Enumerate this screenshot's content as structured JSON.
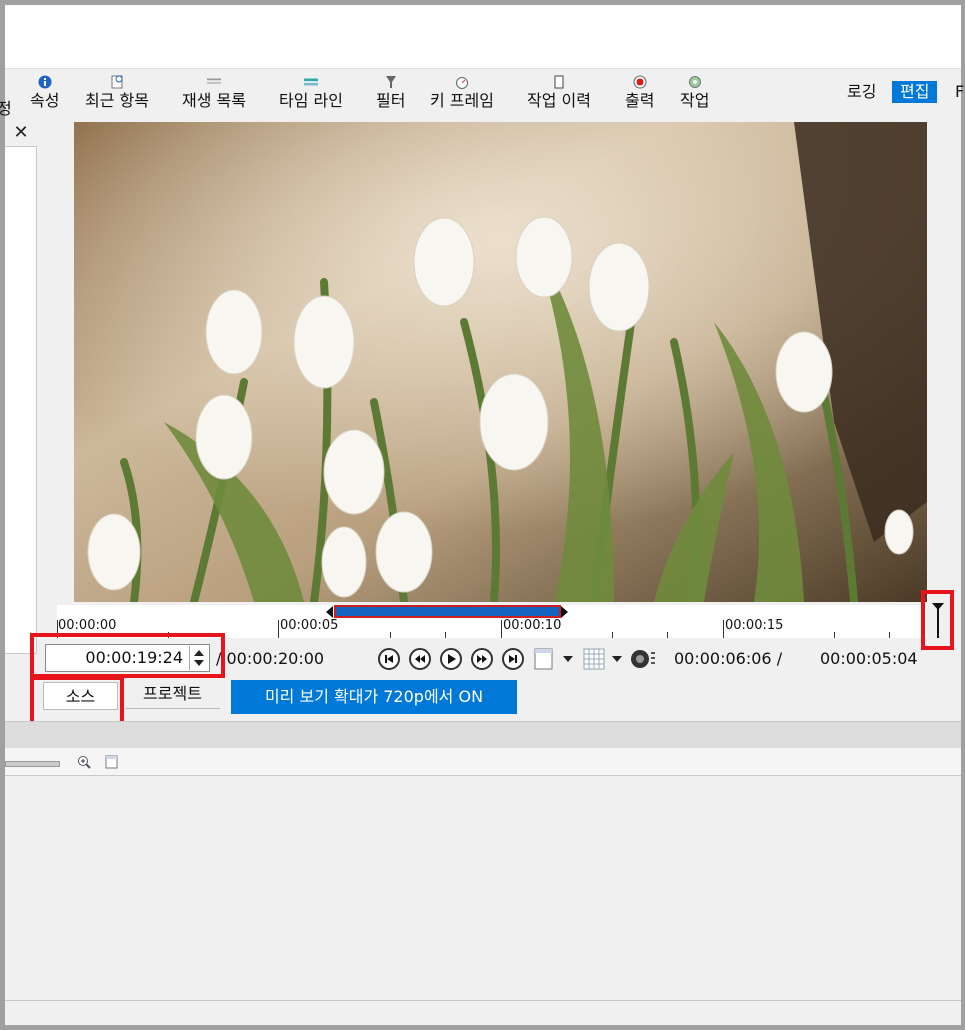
{
  "toolbar": {
    "cut_label": "정",
    "items": [
      {
        "label": "속성",
        "icon": "info-icon"
      },
      {
        "label": "최근 항목",
        "icon": "recent-icon"
      },
      {
        "label": "재생 목록",
        "icon": "playlist-icon"
      },
      {
        "label": "타임 라인",
        "icon": "timeline-icon"
      },
      {
        "label": "필터",
        "icon": "filter-icon"
      },
      {
        "label": "키 프레임",
        "icon": "keyframe-icon"
      },
      {
        "label": "작업 이력",
        "icon": "history-icon"
      },
      {
        "label": "출력",
        "icon": "export-icon"
      },
      {
        "label": "작업",
        "icon": "jobs-icon"
      }
    ],
    "modes": {
      "logging": "로깅",
      "editing": "편집",
      "cut": "F"
    }
  },
  "left_panel": {
    "close_symbol": "✕"
  },
  "ruler": {
    "labels": [
      "00:00:00",
      "00:00:05",
      "00:00:10",
      "00:00:15"
    ]
  },
  "transport": {
    "current_time": "00:00:19:24",
    "total_time": "/ 00:00:20:00",
    "in_point": "00:00:06:06 /",
    "duration": "00:00:05:04"
  },
  "tabs": {
    "source": "소스",
    "project": "프로젝트"
  },
  "banner": {
    "text": "미리 보기 확대가 720p에서 ON"
  },
  "colors": {
    "accent": "#0078d7",
    "highlight": "#e8141b",
    "selection": "#1565c0"
  }
}
